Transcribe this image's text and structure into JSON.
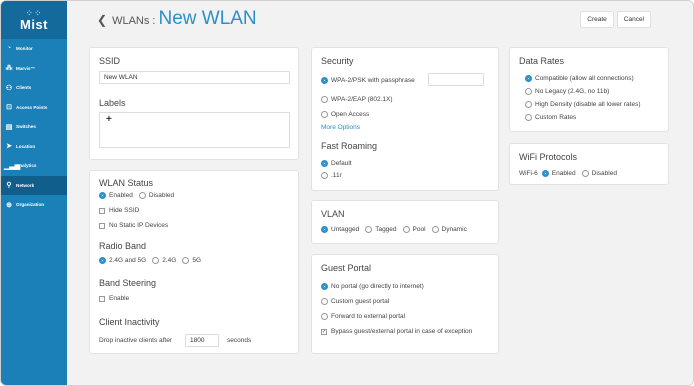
{
  "sidebar": {
    "logo": "Mist",
    "items": [
      {
        "label": "Monitor",
        "icon": "◔"
      },
      {
        "label": "Marvis™",
        "icon": "⁂"
      },
      {
        "label": "Clients",
        "icon": "⚇"
      },
      {
        "label": "Access Points",
        "icon": "⊡"
      },
      {
        "label": "Switches",
        "icon": "▤"
      },
      {
        "label": "Location",
        "icon": "➤"
      },
      {
        "label": "Analytics",
        "icon": "▁▃▅"
      },
      {
        "label": "Network",
        "icon": "⚲"
      },
      {
        "label": "Organization",
        "icon": "⊕"
      }
    ],
    "active_index": 7
  },
  "header": {
    "breadcrumb": "WLANs :",
    "title": "New WLAN",
    "create": "Create",
    "cancel": "Cancel"
  },
  "ssid": {
    "title": "SSID",
    "value": "New WLAN",
    "labels_title": "Labels",
    "add": "+"
  },
  "wlan_status": {
    "title": "WLAN Status",
    "enabled": "Enabled",
    "disabled": "Disabled",
    "hide_ssid": "Hide SSID",
    "no_static_ip": "No Static IP Devices",
    "radio_band_title": "Radio Band",
    "band_both": "2.4G and 5G",
    "band_24": "2.4G",
    "band_5": "5G",
    "band_steering_title": "Band Steering",
    "band_steering_enable": "Enable",
    "inactivity_title": "Client Inactivity",
    "inactivity_label": "Drop inactive clients after",
    "inactivity_value": "1800",
    "inactivity_unit": "seconds"
  },
  "security": {
    "title": "Security",
    "opt1": "WPA-2/PSK with passphrase",
    "opt2": "WPA-2/EAP (802.1X)",
    "opt3": "Open Access",
    "more": "More Options",
    "roaming_title": "Fast Roaming",
    "roam_default": "Default",
    "roam_11r": ".11r"
  },
  "vlan": {
    "title": "VLAN",
    "untagged": "Untagged",
    "tagged": "Tagged",
    "pool": "Pool",
    "dynamic": "Dynamic"
  },
  "guest": {
    "title": "Guest Portal",
    "no_portal": "No portal (go directly to internet)",
    "custom": "Custom guest portal",
    "forward": "Forward to external portal",
    "bypass": "Bypass guest/external portal in case of exception"
  },
  "data_rates": {
    "title": "Data Rates",
    "compatible": "Compatible (allow all connections)",
    "no_legacy": "No Legacy (2.4G, no 11b)",
    "high_density": "High Density (disable all lower rates)",
    "custom": "Custom Rates"
  },
  "wifi": {
    "title": "WiFi Protocols",
    "wifi6": "WiFi-6",
    "enabled": "Enabled",
    "disabled": "Disabled"
  }
}
